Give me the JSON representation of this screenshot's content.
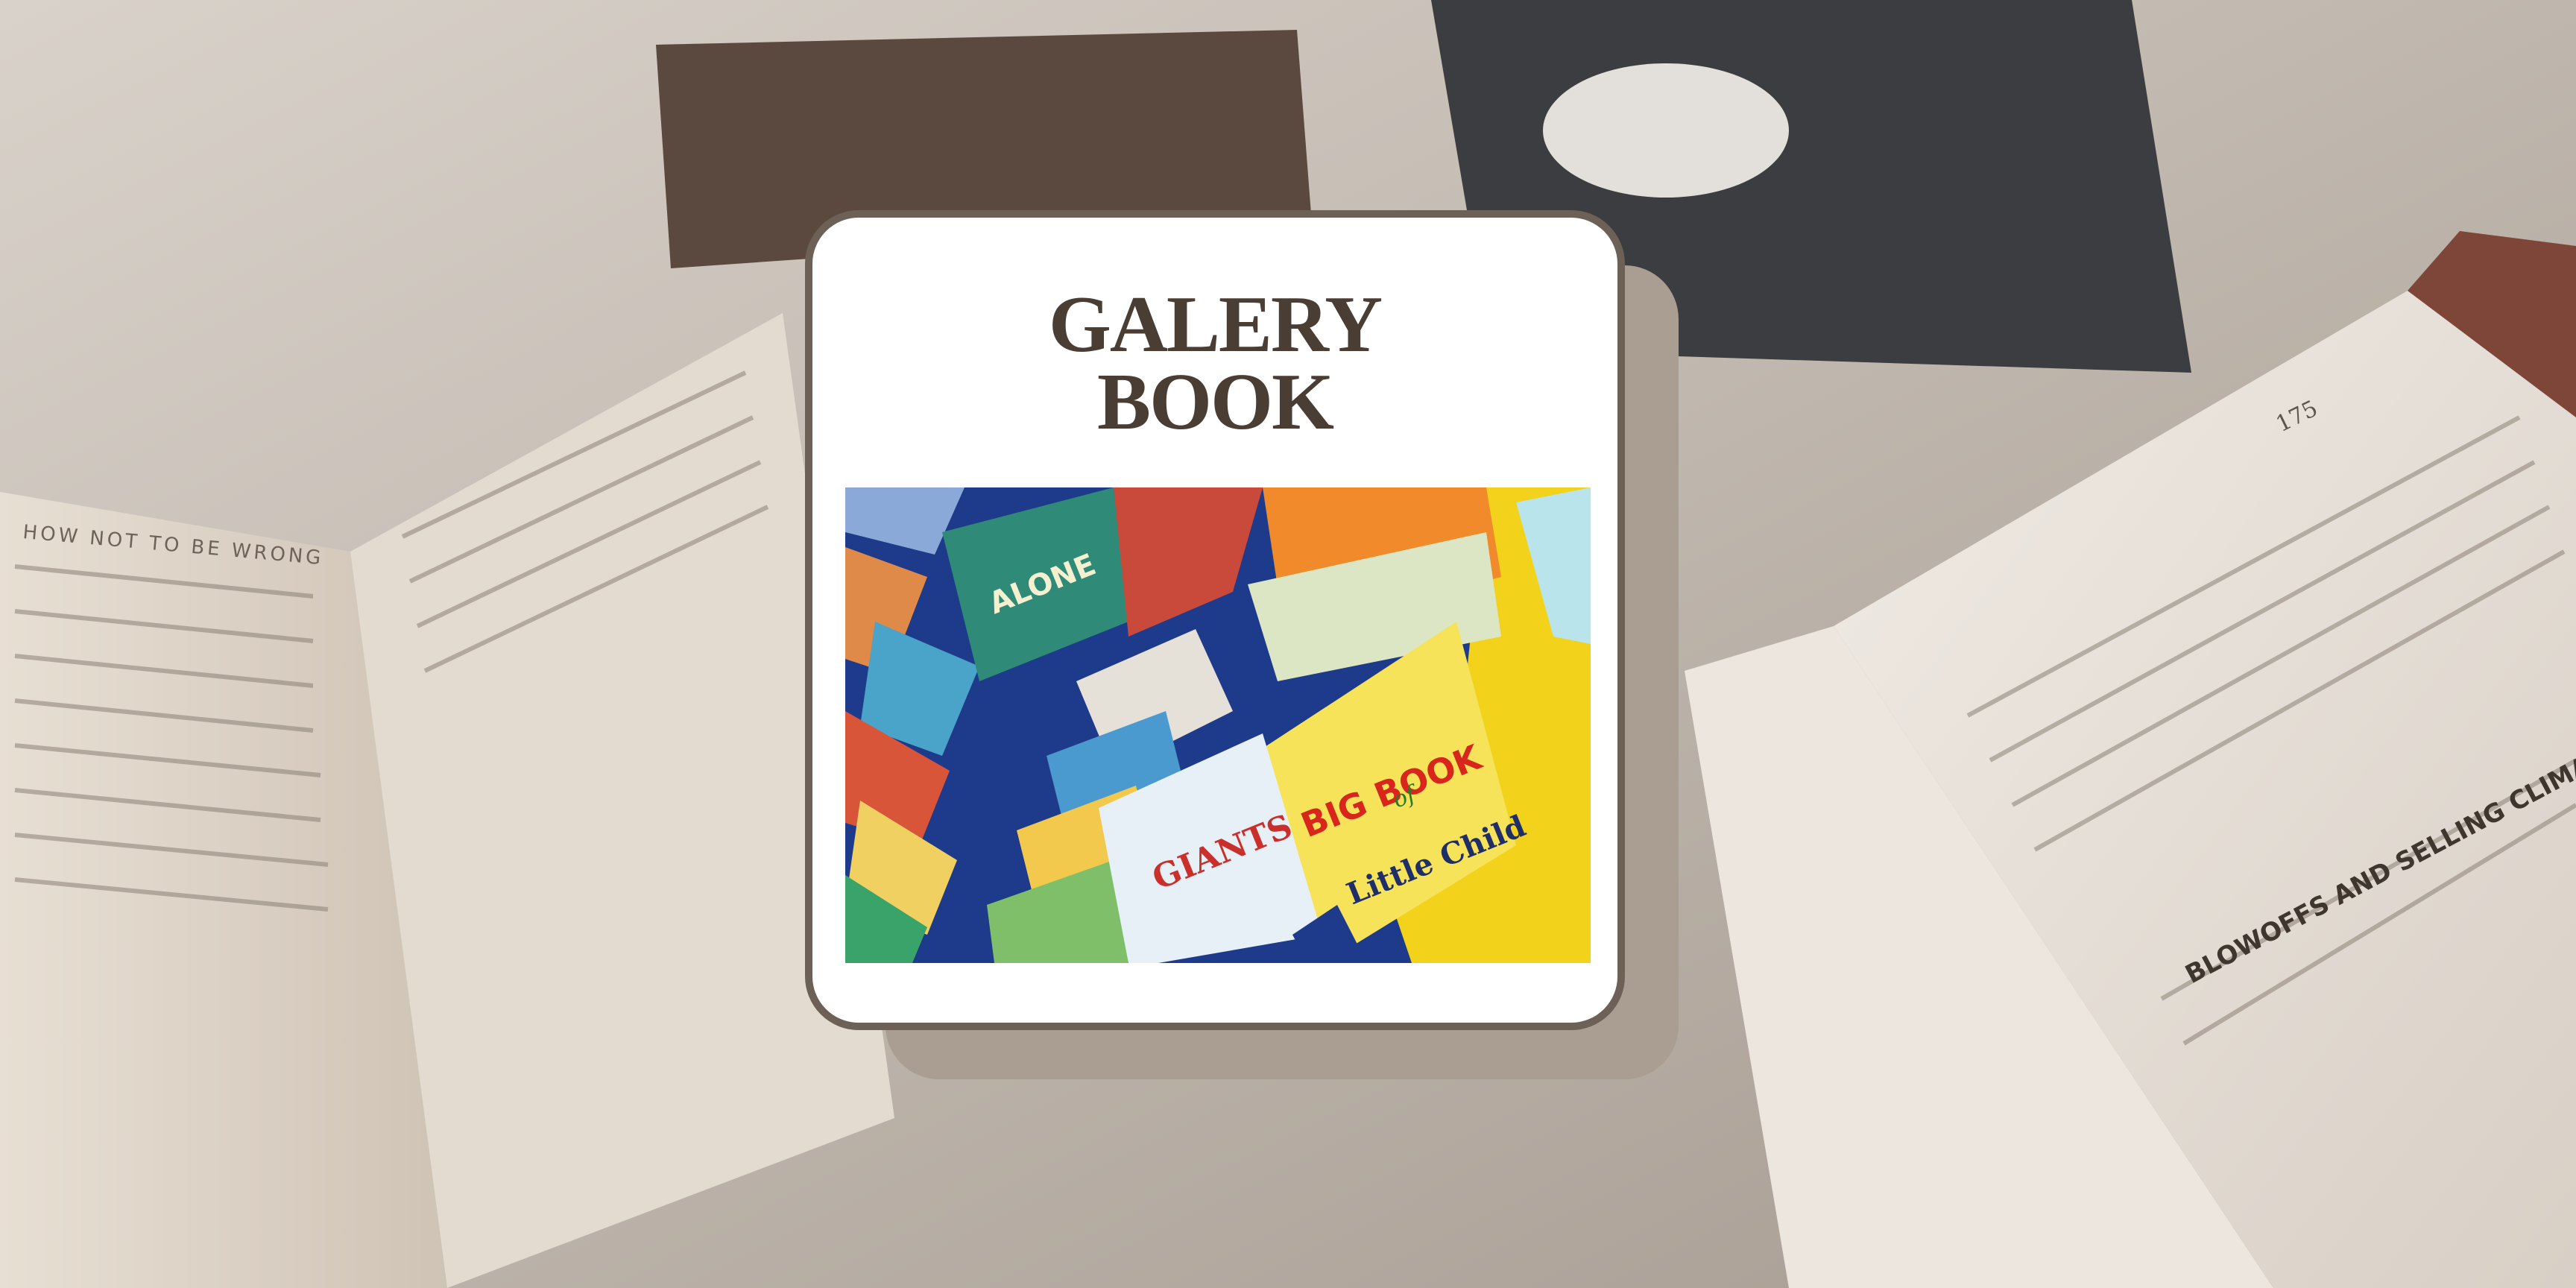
{
  "card": {
    "title_line1": "GALERY",
    "title_line2": "BOOK"
  },
  "photo": {
    "book_big_title": "BIG BOOK",
    "book_big_of": "of",
    "book_big_subtitle": "Little Child",
    "book_giants_title": "GIANTS",
    "book_alone_title": "ALONE"
  },
  "background": {
    "left_page_header": "HOW NOT TO BE WRONG",
    "right_page_number": "175",
    "right_page_section": "BLOWOFFS AND SELLING CLIMAXES"
  },
  "colors": {
    "card_border": "#6d6157",
    "card_shadow": "#aa9d91",
    "title_text": "#4a3d34",
    "accent_yellow": "#f2d21a"
  }
}
